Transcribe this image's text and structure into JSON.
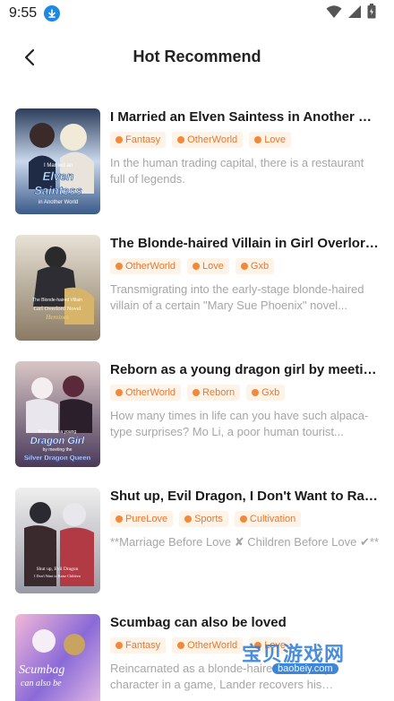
{
  "status": {
    "time": "9:55"
  },
  "header": {
    "title": "Hot Recommend"
  },
  "books": [
    {
      "title": "I Married an Elven Saintess in Another World",
      "tags": [
        "Fantasy",
        "OtherWorld",
        "Love"
      ],
      "desc": "In the human trading capital, there is a restaurant full of legends.",
      "cover_text": [
        "I Married an",
        "Elven",
        "Saintess",
        "in Another World"
      ]
    },
    {
      "title": "The Blonde-haired Villain in Girl Overlord Novel",
      "tags": [
        "OtherWorld",
        "Love",
        "Gxb"
      ],
      "desc": "Transmigrating into the early-stage blonde-haired villain of a certain \"Mary Sue Phoenix\" novel...",
      "cover_text": [
        "The Blonde-haired Villain",
        "Girl Overlord Novel",
        "Heroines"
      ]
    },
    {
      "title": "Reborn as a young dragon girl by meeting the Silver Dragon Queen",
      "tags": [
        "OtherWorld",
        "Reborn",
        "Gxb"
      ],
      "desc": "How many times in life can you have such alpaca-type surprises? Mo Li, a poor human tourist...",
      "cover_text": [
        "Reborn as a young",
        "Dragon Girl",
        "by meeting the",
        "Silver Dragon Queen"
      ]
    },
    {
      "title": "Shut up, Evil Dragon, I Don't Want to Raise Children",
      "tags": [
        "PureLove",
        "Sports",
        "Cultivation"
      ],
      "desc": "**Marriage Before Love ✘  Children Before Love ✔**",
      "cover_text": [
        "Shut up, Evil Dragon",
        "I Don't Want to Raise Children"
      ]
    },
    {
      "title": "Scumbag can also be loved",
      "tags": [
        "Fantasy",
        "OtherWorld",
        "Love"
      ],
      "desc": "Reincarnated as a blonde-haired scumbag character in a game, Lander recovers his memories...",
      "cover_text": [
        "Scumbag",
        "can also be"
      ]
    }
  ],
  "watermark": {
    "text": "宝贝游戏网",
    "url": "baobeiy.com"
  },
  "colors": {
    "tag_text": "#e8772e",
    "tag_bg": "#fff3e8",
    "desc": "#a6a6a6",
    "title": "#1a1a1a"
  }
}
